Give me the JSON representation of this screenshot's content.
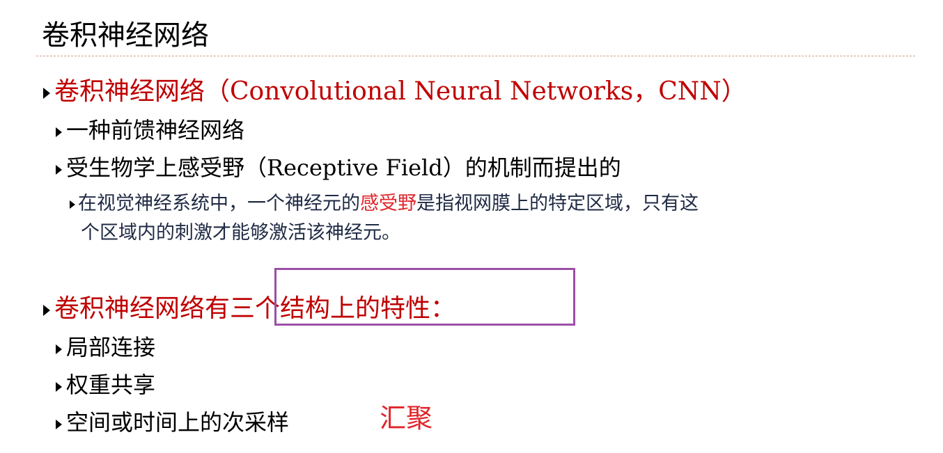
{
  "title": "卷积神经网络",
  "bullets": {
    "b1": "卷积神经网络（Convolutional Neural Networks，CNN）",
    "b1a": "一种前馈神经网络",
    "b1b": "受生物学上感受野（Receptive Field）的机制而提出的",
    "b1c_pre": "在视觉神经系统中，一个神经元的",
    "b1c_hl": "感受野",
    "b1c_post": "是指视网膜上的特定区域，只有这",
    "b1c_line2": "个区域内的刺激才能够激活该神经元。",
    "b2": "卷积神经网络有三个结构上的特性：",
    "b2a": "局部连接",
    "b2b": "权重共享",
    "b2c": "空间或时间上的次采样"
  },
  "annotation": "汇聚",
  "colors": {
    "heading_red": "#c00000",
    "highlight_red": "#e0252b",
    "box_purple": "#9b4fa6"
  }
}
